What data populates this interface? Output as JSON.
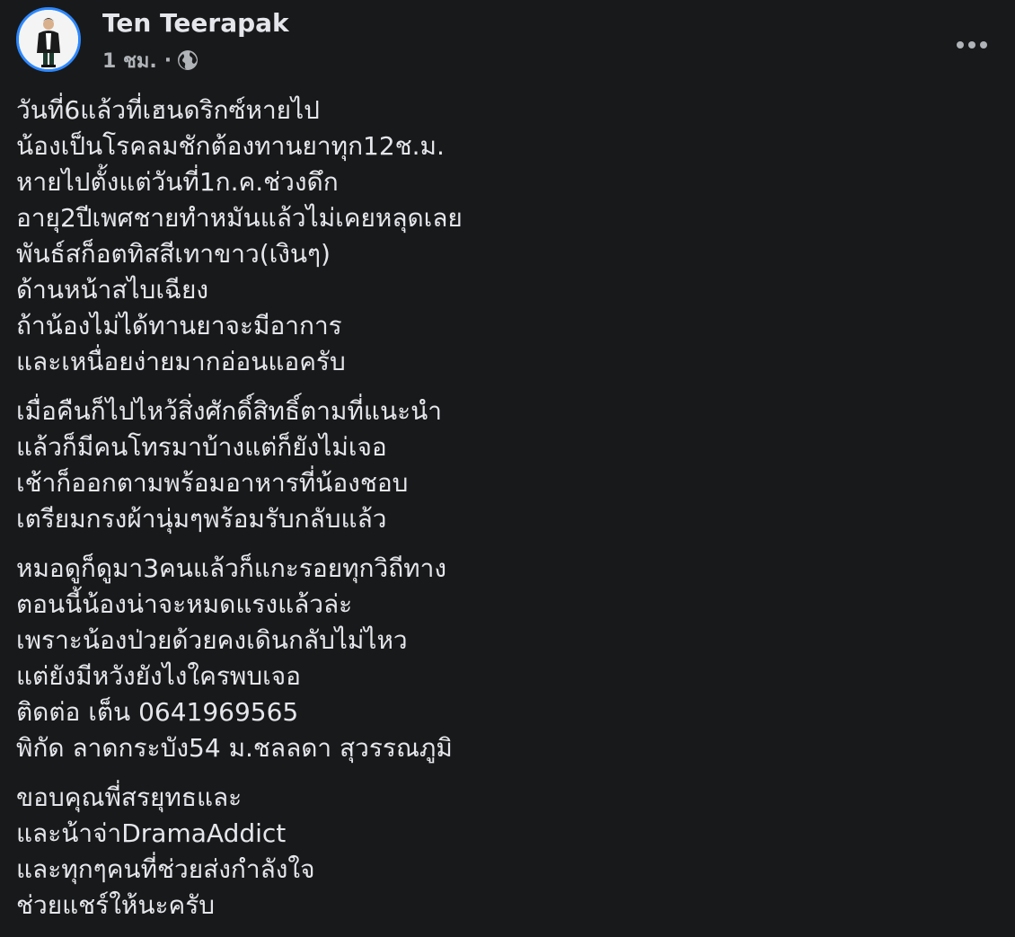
{
  "post": {
    "author": "Ten Teerapak",
    "time": "1 ชม.",
    "separator": "·",
    "privacy_icon": "globe-icon",
    "more_icon": "more-options-icon",
    "paragraphs": [
      [
        "วันที่6แล้วที่เฮนดริกซ์หายไป",
        "น้องเป็นโรคลมชักต้องทานยาทุก12ช.ม.",
        "หายไปตั้งแต่วันที่1ก.ค.ช่วงดึก",
        "อายุ2ปีเพศชายทำหมันแล้วไม่เคยหลุดเลย",
        "พันธ์สก็อตทิสสีเทาขาว(เงินๆ)",
        "ด้านหน้าสไบเฉียง",
        "ถ้าน้องไม่ได้ทานยาจะมีอาการ",
        "และเหนื่อยง่ายมากอ่อนแอครับ"
      ],
      [
        "เมื่อคืนก็ไปไหว้สิ่งศักดิ์สิทธิ์ตามที่แนะนำ",
        "แล้วก็มีคนโทรมาบ้างแต่ก็ยังไม่เจอ",
        "เช้าก็ออกตามพร้อมอาหารที่น้องชอบ",
        "เตรียมกรงผ้านุ่มๆพร้อมรับกลับแล้ว"
      ],
      [
        "หมอดูก็ดูมา3คนแล้วก็แกะรอยทุกวิถีทาง",
        "ตอนนี้น้องน่าจะหมดแรงแล้วล่ะ",
        "เพราะน้องป่วยด้วยคงเดินกลับไม่ไหว",
        "แต่ยังมีหวังยังไงใครพบเจอ",
        "ติดต่อ เต็น 0641969565",
        "พิกัด ลาดกระบัง54 ม.ชลลดา สุวรรณภูมิ"
      ],
      [
        "ขอบคุณพี่สรยุทธและ",
        "และน้าจ่าDramaAddict",
        "และทุกๆคนที่ช่วยส่งกำลังใจ",
        "ช่วยแชร์ให้นะครับ"
      ]
    ]
  },
  "colors": {
    "background": "#18191a",
    "primary_text": "#e4e6eb",
    "secondary_text": "#b0b3b8",
    "avatar_ring": "#2d88ff"
  }
}
